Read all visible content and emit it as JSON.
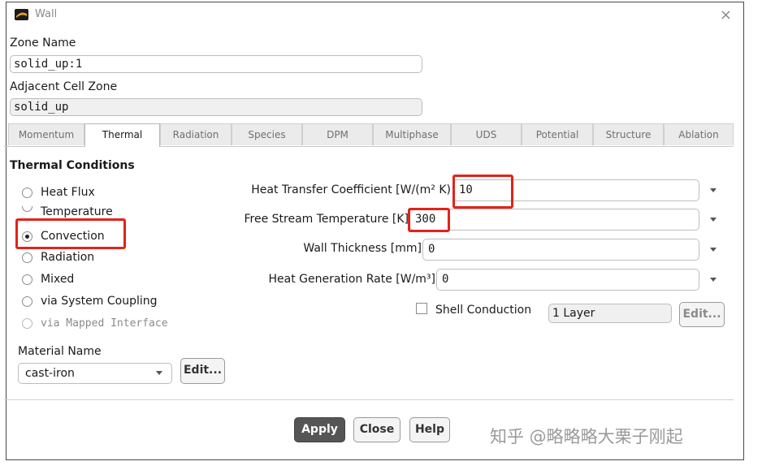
{
  "window": {
    "title": "Wall",
    "close_glyph": "×"
  },
  "zone": {
    "name_label": "Zone Name",
    "name_value": "solid_up:1",
    "adjacent_label": "Adjacent Cell Zone",
    "adjacent_value": "solid_up"
  },
  "tabs": [
    {
      "label": "Momentum"
    },
    {
      "label": "Thermal"
    },
    {
      "label": "Radiation"
    },
    {
      "label": "Species"
    },
    {
      "label": "DPM"
    },
    {
      "label": "Multiphase"
    },
    {
      "label": "UDS"
    },
    {
      "label": "Potential"
    },
    {
      "label": "Structure"
    },
    {
      "label": "Ablation"
    }
  ],
  "active_tab": "Thermal",
  "thermal": {
    "section_title": "Thermal Conditions",
    "conditions": [
      {
        "label": "Heat Flux",
        "checked": false,
        "disabled": false
      },
      {
        "label": "Temperature",
        "checked": false,
        "disabled": false
      },
      {
        "label": "Convection",
        "checked": true,
        "disabled": false
      },
      {
        "label": "Radiation",
        "checked": false,
        "disabled": false
      },
      {
        "label": "Mixed",
        "checked": false,
        "disabled": false
      },
      {
        "label": "via System Coupling",
        "checked": false,
        "disabled": false
      },
      {
        "label": "via Mapped Interface",
        "checked": false,
        "disabled": true
      }
    ],
    "params": [
      {
        "label": "Heat Transfer Coefficient [W/(m² K)",
        "value": "10"
      },
      {
        "label": "Free Stream Temperature [K]",
        "value": "300"
      },
      {
        "label": "Wall Thickness [mm]",
        "value": "0"
      },
      {
        "label": "Heat Generation Rate [W/m³]",
        "value": "0"
      }
    ],
    "shell": {
      "label": "Shell Conduction",
      "checked": false,
      "layers_value": "1 Layer",
      "edit_label": "Edit..."
    },
    "material": {
      "label": "Material Name",
      "value": "cast-iron",
      "edit_label": "Edit..."
    }
  },
  "footer": {
    "apply_label": "Apply",
    "close_label": "Close",
    "help_label": "Help"
  },
  "watermark": "知乎 @略略略大栗子刚起",
  "colors": {
    "highlight": "#e2231a",
    "primary_button": "#555555"
  },
  "icons": {
    "app": "fluent-logo-icon",
    "dropdown": "chevron-down-icon"
  }
}
